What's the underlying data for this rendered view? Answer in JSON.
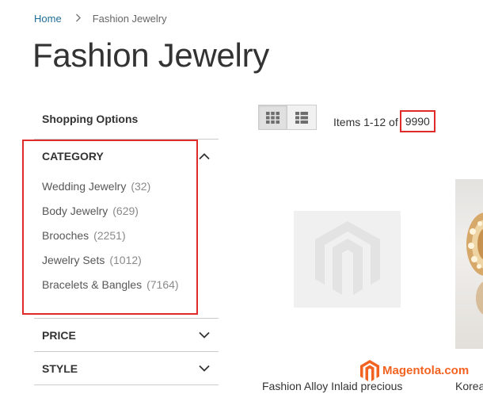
{
  "breadcrumb": {
    "home": "Home",
    "separator": ">",
    "current": "Fashion Jewelry"
  },
  "page_title": "Fashion Jewelry",
  "sidebar": {
    "heading": "Shopping Options",
    "category": {
      "title": "CATEGORY",
      "expanded": true,
      "items": [
        {
          "label": "Wedding Jewelry",
          "count": "(32)"
        },
        {
          "label": "Body Jewelry",
          "count": "(629)"
        },
        {
          "label": "Brooches",
          "count": "(2251)"
        },
        {
          "label": "Jewelry Sets",
          "count": "(1012)"
        },
        {
          "label": "Bracelets & Bangles",
          "count": "(7164)"
        }
      ]
    },
    "filters": [
      {
        "title": "PRICE",
        "expanded": false
      },
      {
        "title": "STYLE",
        "expanded": false
      }
    ]
  },
  "toolbar": {
    "modes": [
      {
        "name": "grid",
        "icon": "grid-icon",
        "active": true
      },
      {
        "name": "list",
        "icon": "list-icon",
        "active": false
      }
    ],
    "amount_prefix": "Items 1-12 of",
    "amount_total": "9990"
  },
  "products": [
    {
      "name": "Fashion Alloy Inlaid precious",
      "image": "placeholder-image-icon"
    },
    {
      "name": "Korea",
      "image": "ring-photo"
    }
  ],
  "watermark": {
    "text": "Magentola.com",
    "icon": "magento-logo-icon"
  },
  "colors": {
    "link": "#1f6d99",
    "highlight": "#e02b2b",
    "brand": "#f26322",
    "border": "#cccccc"
  }
}
